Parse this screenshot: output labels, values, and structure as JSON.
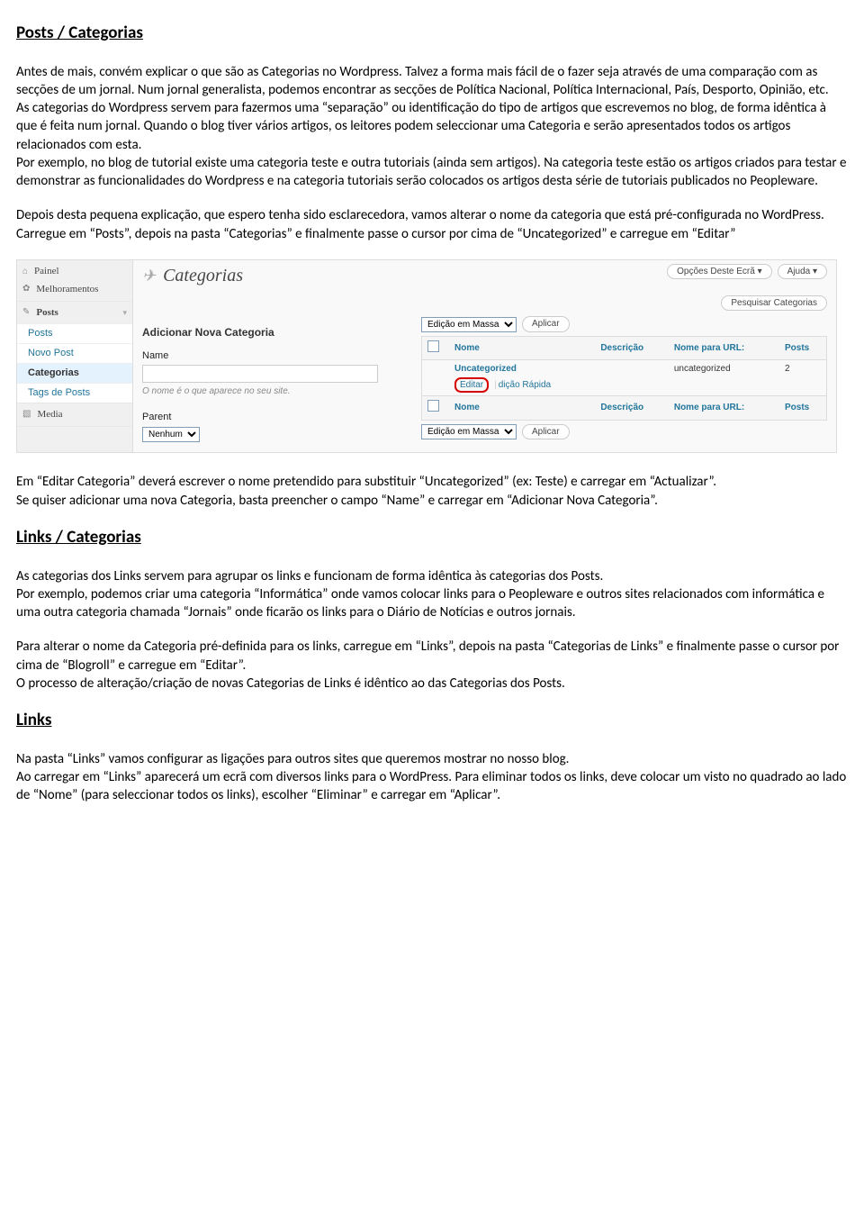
{
  "h_posts_cat": "Posts / Categorias",
  "p1": "Antes de mais, convém explicar o que são as Categorias no Wordpress. Talvez a forma mais fácil de o fazer seja através de uma comparação com as secções de um jornal. Num jornal generalista, podemos encontrar as secções de Política Nacional, Política Internacional, País, Desporto, Opinião, etc.\nAs categorias do Wordpress servem para fazermos uma “separação” ou identificação do tipo de artigos que escrevemos no blog, de forma idêntica à que é feita num jornal. Quando o blog tiver vários artigos, os leitores podem seleccionar uma Categoria e serão apresentados todos os artigos relacionados com esta.\nPor exemplo, no blog de tutorial existe uma categoria teste e outra tutoriais (ainda sem artigos). Na categoria teste estão os artigos criados para testar e demonstrar as funcionalidades do Wordpress e na categoria tutoriais serão colocados os artigos desta série de tutoriais publicados no Peopleware.",
  "p2": "Depois desta pequena explicação, que espero tenha sido esclarecedora, vamos alterar o nome da categoria que está pré-configurada no WordPress.\nCarregue em “Posts”, depois na pasta “Categorias” e finalmente passe o cursor por cima de “Uncategorized” e carregue em “Editar”",
  "p3": "Em “Editar Categoria” deverá escrever o nome pretendido para substituir “Uncategorized” (ex: Teste) e carregar em “Actualizar”.\nSe quiser adicionar uma nova Categoria, basta preencher o campo “Name” e carregar em “Adicionar Nova Categoria”.",
  "h_links_cat": "Links / Categorias",
  "p4": "As categorias dos Links servem para agrupar os links e funcionam de forma idêntica às categorias dos Posts.\nPor exemplo, podemos criar uma categoria “Informática” onde vamos colocar links para o Peopleware e outros sites relacionados com informática e uma outra categoria chamada “Jornais” onde ficarão os links para o Diário de Notícias e outros jornais.",
  "p5": "Para alterar o nome da Categoria pré-definida para os links, carregue em “Links”, depois na pasta “Categorias de Links” e finalmente passe o cursor por cima de “Blogroll” e carregue em “Editar”.\nO processo de alteração/criação de novas Categorias de Links é idêntico ao das Categorias dos Posts.",
  "h_links": "Links",
  "p6": "Na pasta “Links” vamos configurar as ligações para outros sites que queremos mostrar no nosso blog.\nAo carregar em “Links” aparecerá um ecrã com diversos links para o WordPress. Para eliminar todos os links, deve colocar um visto no quadrado ao lado de “Nome” (para seleccionar todos os links), escolher “Eliminar” e carregar em “Aplicar”.",
  "wp": {
    "topbtn1": "Opções Deste Ecrã ▾",
    "topbtn2": "Ajuda ▾",
    "searchbtn": "Pesquisar Categorias",
    "title": "Categorias",
    "sidebar": {
      "painel": "Painel",
      "melhor": "Melhoramentos",
      "posts": "Posts",
      "posts_sub": [
        "Posts",
        "Novo Post",
        "Categorias",
        "Tags de Posts"
      ],
      "media": "Media"
    },
    "left": {
      "add_heading": "Adicionar Nova Categoria",
      "name": "Name",
      "name_help": "O nome é o que aparece no seu site.",
      "parent": "Parent",
      "parent_val": "Nenhum"
    },
    "toolbar": {
      "bulk": "Edição em Massa",
      "apply": "Aplicar"
    },
    "table": {
      "col_nome": "Nome",
      "col_desc": "Descrição",
      "col_url": "Nome para URL:",
      "col_posts": "Posts",
      "row_name": "Uncategorized",
      "row_slug": "uncategorized",
      "row_count": "2",
      "action_edit": "Editar",
      "action_quick": "dição Rápida"
    }
  }
}
